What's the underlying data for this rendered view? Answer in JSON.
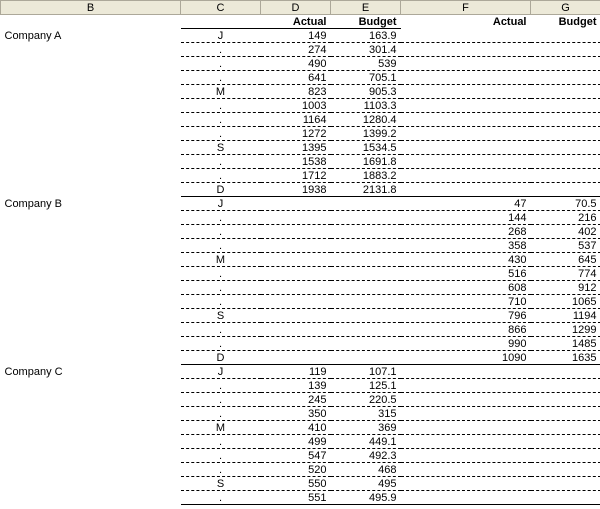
{
  "columns": [
    "B",
    "C",
    "D",
    "E",
    "F",
    "G"
  ],
  "headers": {
    "d": "Actual",
    "e": "Budget",
    "f": "Actual",
    "g": "Budget"
  },
  "months": [
    "J",
    ".",
    ".",
    ".",
    "M",
    ".",
    ".",
    ".",
    "S",
    ".",
    ".",
    "D"
  ],
  "companies": [
    {
      "name": "Company A",
      "cols": "de",
      "rows": [
        [
          149,
          163.9
        ],
        [
          274,
          301.4
        ],
        [
          490,
          539
        ],
        [
          641,
          705.1
        ],
        [
          823,
          905.3
        ],
        [
          1003,
          1103.3
        ],
        [
          1164,
          1280.4
        ],
        [
          1272,
          1399.2
        ],
        [
          1395,
          1534.5
        ],
        [
          1538,
          1691.8
        ],
        [
          1712,
          1883.2
        ],
        [
          1938,
          2131.8
        ]
      ]
    },
    {
      "name": "Company B",
      "cols": "fg",
      "rows": [
        [
          47,
          70.5
        ],
        [
          144,
          216
        ],
        [
          268,
          402
        ],
        [
          358,
          537
        ],
        [
          430,
          645
        ],
        [
          516,
          774
        ],
        [
          608,
          912
        ],
        [
          710,
          1065
        ],
        [
          796,
          1194
        ],
        [
          866,
          1299
        ],
        [
          990,
          1485
        ],
        [
          1090,
          1635
        ]
      ]
    },
    {
      "name": "Company C",
      "cols": "de",
      "rows": [
        [
          119,
          107.1
        ],
        [
          139,
          125.1
        ],
        [
          245,
          220.5
        ],
        [
          350,
          315
        ],
        [
          410,
          369
        ],
        [
          499,
          449.1
        ],
        [
          547,
          492.3
        ],
        [
          520,
          468
        ],
        [
          550,
          495
        ],
        [
          551,
          495.9
        ]
      ]
    }
  ]
}
